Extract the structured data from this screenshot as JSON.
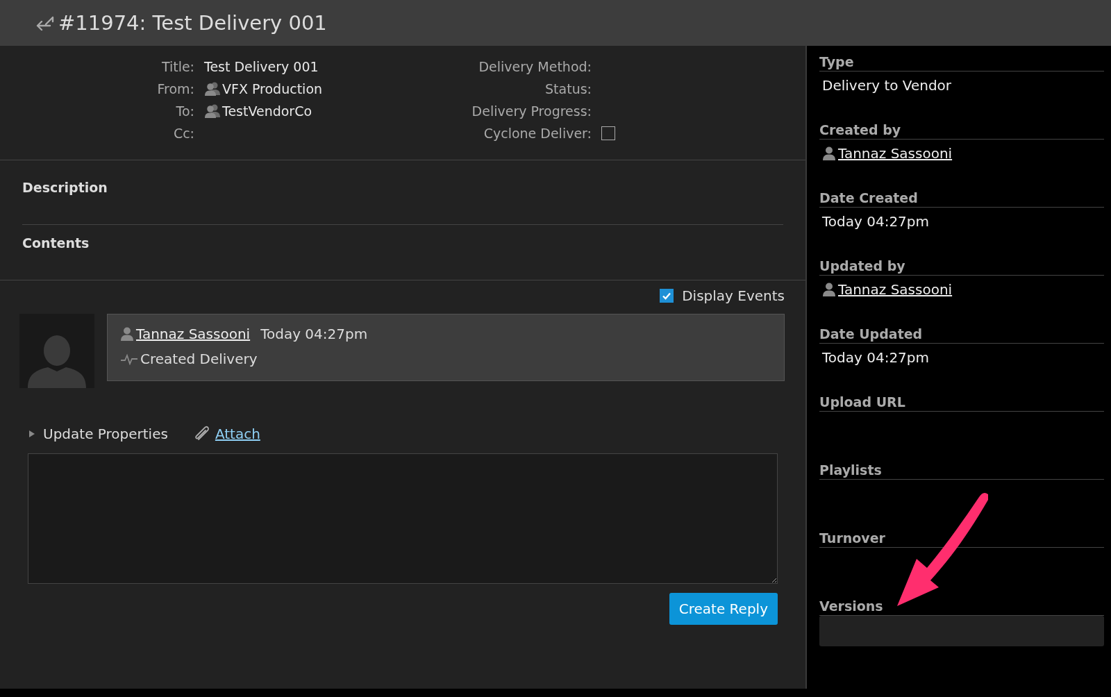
{
  "header": {
    "title": "#11974: Test Delivery 001"
  },
  "fields_left": [
    {
      "label": "Title:",
      "value": "Test Delivery 001",
      "kind": "text"
    },
    {
      "label": "From:",
      "value": "VFX Production",
      "kind": "group"
    },
    {
      "label": "To:",
      "value": "TestVendorCo",
      "kind": "group"
    },
    {
      "label": "Cc:",
      "kind": "empty"
    }
  ],
  "fields_right": [
    {
      "label": "Delivery Method:",
      "kind": "empty"
    },
    {
      "label": "Status:",
      "kind": "empty"
    },
    {
      "label": "Delivery Progress:",
      "kind": "empty"
    },
    {
      "label": "Cyclone Deliver:",
      "kind": "checkbox",
      "checked": false
    }
  ],
  "sections": [
    {
      "title": "Description"
    },
    {
      "title": "Contents"
    }
  ],
  "display_events": {
    "label": "Display Events",
    "checked": true
  },
  "events": [
    {
      "user": "Tannaz Sassooni",
      "time": "Today 04:27pm",
      "action": "Created Delivery"
    }
  ],
  "reply": {
    "update_properties": "Update Properties",
    "expanded": false,
    "attach": "Attach",
    "button": "Create Reply"
  },
  "sidebar": [
    {
      "heading": "Type",
      "value": "Delivery to Vendor",
      "kind": "text"
    },
    {
      "heading": "Created by",
      "value": "Tannaz Sassooni",
      "kind": "user"
    },
    {
      "heading": "Date Created",
      "value": "Today 04:27pm",
      "kind": "text"
    },
    {
      "heading": "Updated by",
      "value": "Tannaz Sassooni",
      "kind": "user"
    },
    {
      "heading": "Date Updated",
      "value": "Today 04:27pm",
      "kind": "text"
    },
    {
      "heading": "Upload URL",
      "kind": "empty"
    },
    {
      "heading": "Playlists",
      "kind": "empty"
    },
    {
      "heading": "Turnover",
      "kind": "empty"
    },
    {
      "heading": "Versions",
      "kind": "box"
    }
  ]
}
